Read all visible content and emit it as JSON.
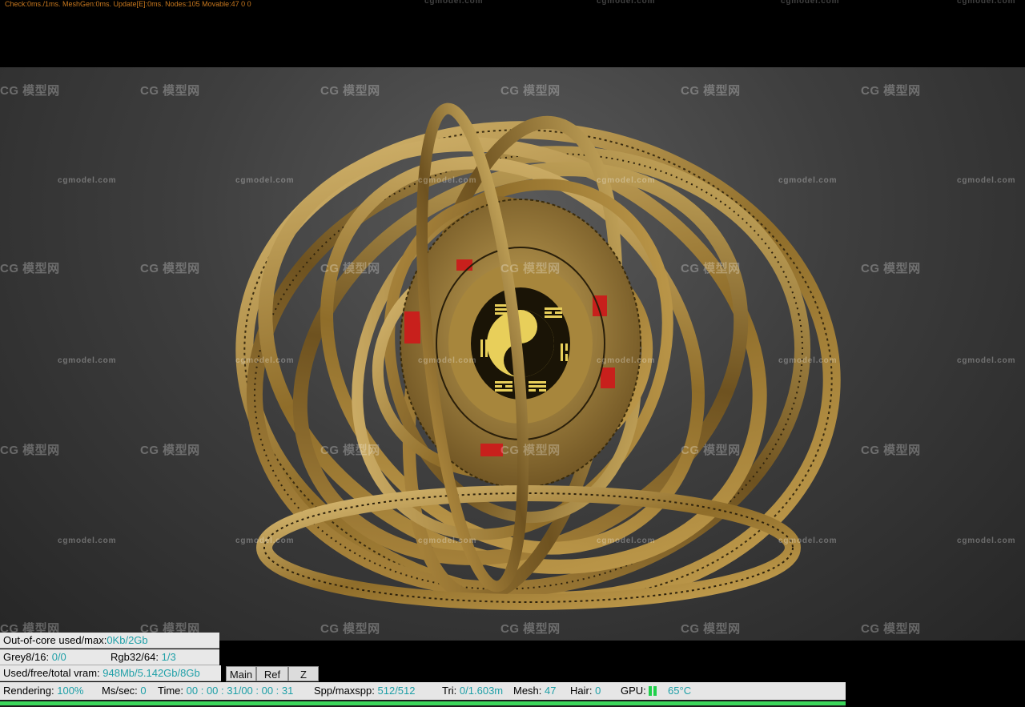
{
  "debug": {
    "line": "Check:0ms./1ms. MeshGen:0ms. Update[E]:0ms. Nodes:105 Movable:47  0 0"
  },
  "watermarks": {
    "logo": "CG 模型网",
    "site": "cgmodel.com"
  },
  "stats": {
    "out_of_core_label": "Out-of-core used/max:",
    "out_of_core_value": "0Kb/2Gb",
    "grey_label": "Grey8/16:",
    "grey_value": "0/0",
    "rgb_label": "Rgb32/64:",
    "rgb_value": "1/3",
    "vram_label": "Used/free/total vram:",
    "vram_value": "948Mb/5.142Gb/8Gb"
  },
  "tabs": [
    "Main",
    "Ref",
    "Z"
  ],
  "status": {
    "rendering_label": "Rendering:",
    "rendering_value": "100%",
    "ms_label": "Ms/sec:",
    "ms_value": "0",
    "time_label": "Time:",
    "time_value": "00 : 00 : 31/00 : 00 : 31",
    "spp_label": "Spp/maxspp:",
    "spp_value": "512/512",
    "tri_label": "Tri:",
    "tri_value": "0/1.603m",
    "mesh_label": "Mesh:",
    "mesh_value": "47",
    "hair_label": "Hair:",
    "hair_value": "0",
    "gpu_label": "GPU:",
    "gpu_temp": "65°C",
    "progress": 1.0
  },
  "colors": {
    "accent_cyan": "#1fa0a8",
    "progress_green": "#3bd65a",
    "debug_orange": "#c8781e",
    "gold": "#b8943f"
  },
  "scene": {
    "icon": "armillary-sphere-taiji-render"
  }
}
